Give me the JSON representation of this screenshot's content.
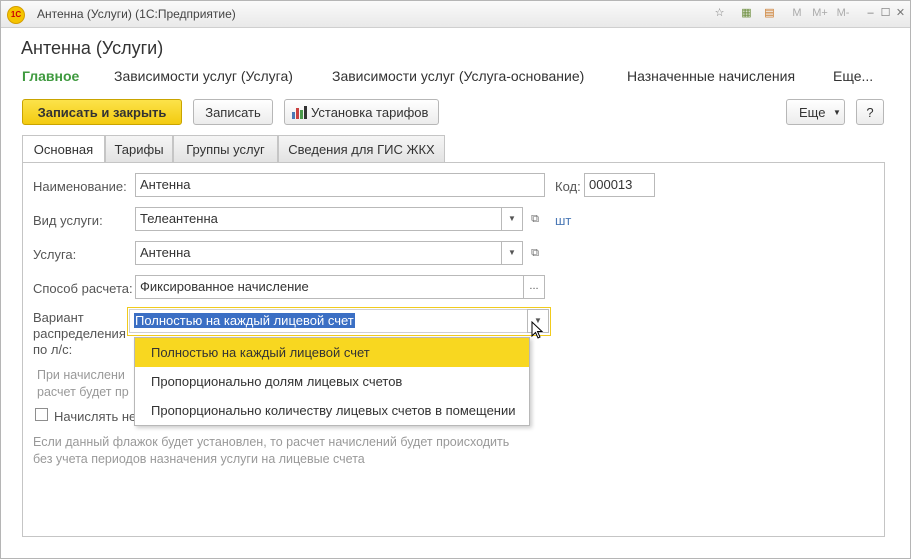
{
  "window": {
    "title": "Антенна (Услуги)  (1С:Предприятие)",
    "toolbar_icons": [
      "favorite-icon",
      "calculator-icon",
      "calendar-icon"
    ],
    "memory_buttons": [
      "M",
      "M+",
      "M-"
    ],
    "min": "–",
    "max": "☐",
    "close": "✕"
  },
  "doc_title": "Антенна (Услуги)",
  "nav": [
    {
      "label": "Главное",
      "active": true
    },
    {
      "label": "Зависимости услуг (Услуга)"
    },
    {
      "label": "Зависимости услуг (Услуга-основание)"
    },
    {
      "label": "Назначенные начисления"
    },
    {
      "label": "Еще..."
    }
  ],
  "toolbar": {
    "save_close": "Записать и закрыть",
    "save": "Записать",
    "tariffs": "Установка тарифов",
    "more": "Еще",
    "help": "?"
  },
  "tabs": [
    "Основная",
    "Тарифы",
    "Группы услуг",
    "Сведения для ГИС ЖКХ"
  ],
  "form": {
    "name_label": "Наименование:",
    "name_value": "Антенна",
    "code_label": "Код:",
    "code_value": "000013",
    "service_type_label": "Вид услуги:",
    "service_type_value": "Телеантенна",
    "unit_link": "шт",
    "service_label": "Услуга:",
    "service_value": "Антенна",
    "calc_method_label": "Способ расчета:",
    "calc_method_value": "Фиксированное начисление",
    "distribution_label_1": "Вариант",
    "distribution_label_2": "распределения",
    "distribution_label_3": "по л/с:",
    "distribution_value": "Полностью на каждый лицевой счет",
    "hint1_line1": "При начислени",
    "hint1_line2": "расчет будет пр",
    "checkbox_label": "Начислять не",
    "hint2_line1": "Если данный флажок будет установлен, то расчет начислений будет происходить",
    "hint2_line2": "без учета периодов назначения услуги на лицевые счета"
  },
  "dropdown": {
    "options": [
      "Полностью на каждый лицевой счет",
      "Пропорционально долям лицевых счетов",
      "Пропорционально количеству лицевых счетов в помещении"
    ],
    "selected_index": 0
  },
  "colors": {
    "accent_green": "#3f9a3f",
    "primary_yellow": "#f3cb10",
    "link_blue": "#4a78b5"
  }
}
